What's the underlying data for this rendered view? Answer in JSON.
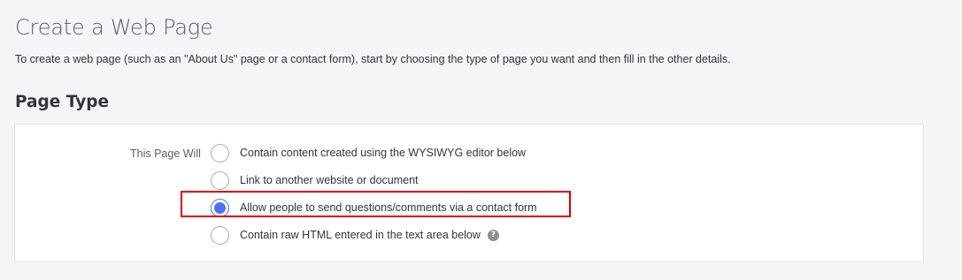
{
  "header": {
    "title": "Create a Web Page",
    "intro": "To create a web page (such as an \"About Us\" page or a contact form), start by choosing the type of page you want and then fill in the other details."
  },
  "page_type": {
    "heading": "Page Type",
    "field_label": "This Page Will",
    "options": [
      {
        "label": "Contain content created using the WYSIWYG editor below",
        "selected": false
      },
      {
        "label": "Link to another website or document",
        "selected": false
      },
      {
        "label": "Allow people to send questions/comments via a contact form",
        "selected": true
      },
      {
        "label": "Contain raw HTML entered in the text area below",
        "selected": false,
        "help_icon": "help-icon"
      }
    ],
    "help_glyph": "?"
  },
  "colors": {
    "accent": "#4b71fc",
    "highlight": "#e00000",
    "background": "#f4f5f7",
    "panel": "#ffffff"
  }
}
